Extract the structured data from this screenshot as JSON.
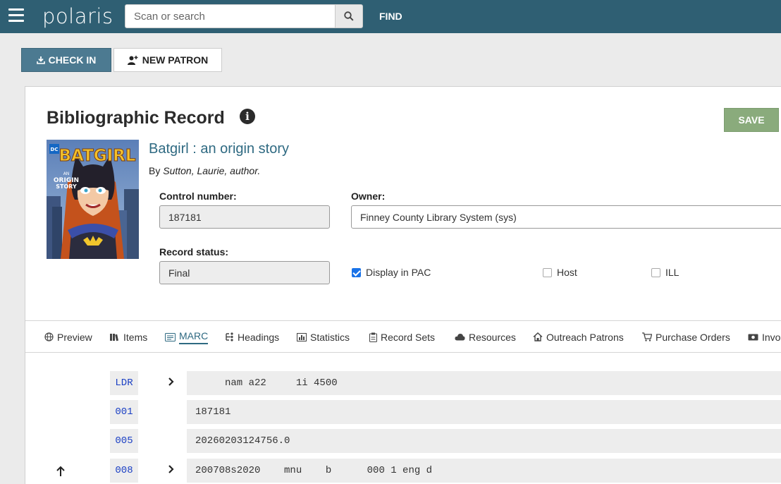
{
  "header": {
    "logo": "polaris",
    "search_placeholder": "Scan or search",
    "find_label": "FIND"
  },
  "actions": {
    "checkin_label": "CHECK IN",
    "new_patron_label": "NEW PATRON"
  },
  "record": {
    "title": "Bibliographic Record",
    "save_label": "SAVE",
    "book_title": "Batgirl : an origin story",
    "by_prefix": "By",
    "author": "Sutton, Laurie, author.",
    "cover": {
      "brand": "DC",
      "title": "BATGIRL",
      "subtitle_a": "AN",
      "subtitle_b": "ORIGIN",
      "subtitle_c": "STORY"
    },
    "control_number_label": "Control number:",
    "control_number": "187181",
    "owner_label": "Owner:",
    "owner": "Finney County Library System (sys)",
    "record_status_label": "Record status:",
    "record_status": "Final",
    "display_in_pac_label": "Display in PAC",
    "display_in_pac": true,
    "host_label": "Host",
    "host": false,
    "ill_label": "ILL",
    "ill": false
  },
  "tabs": [
    {
      "label": "Preview",
      "icon": "globe-icon"
    },
    {
      "label": "Items",
      "icon": "items-icon"
    },
    {
      "label": "MARC",
      "icon": "marc-icon",
      "active": true
    },
    {
      "label": "Headings",
      "icon": "headings-icon"
    },
    {
      "label": "Statistics",
      "icon": "statistics-icon"
    },
    {
      "label": "Record Sets",
      "icon": "record-sets-icon"
    },
    {
      "label": "Resources",
      "icon": "cloud-icon"
    },
    {
      "label": "Outreach Patrons",
      "icon": "home-icon"
    },
    {
      "label": "Purchase Orders",
      "icon": "cart-icon"
    },
    {
      "label": "Invo",
      "icon": "money-icon"
    }
  ],
  "marc": [
    {
      "tag": "LDR",
      "value": "     nam a22     1i 4500"
    },
    {
      "tag": "001",
      "value": "187181"
    },
    {
      "tag": "005",
      "value": "20260203124756.0"
    },
    {
      "tag": "008",
      "value": "200708s2020    mnu    b      000 1 eng d"
    }
  ]
}
